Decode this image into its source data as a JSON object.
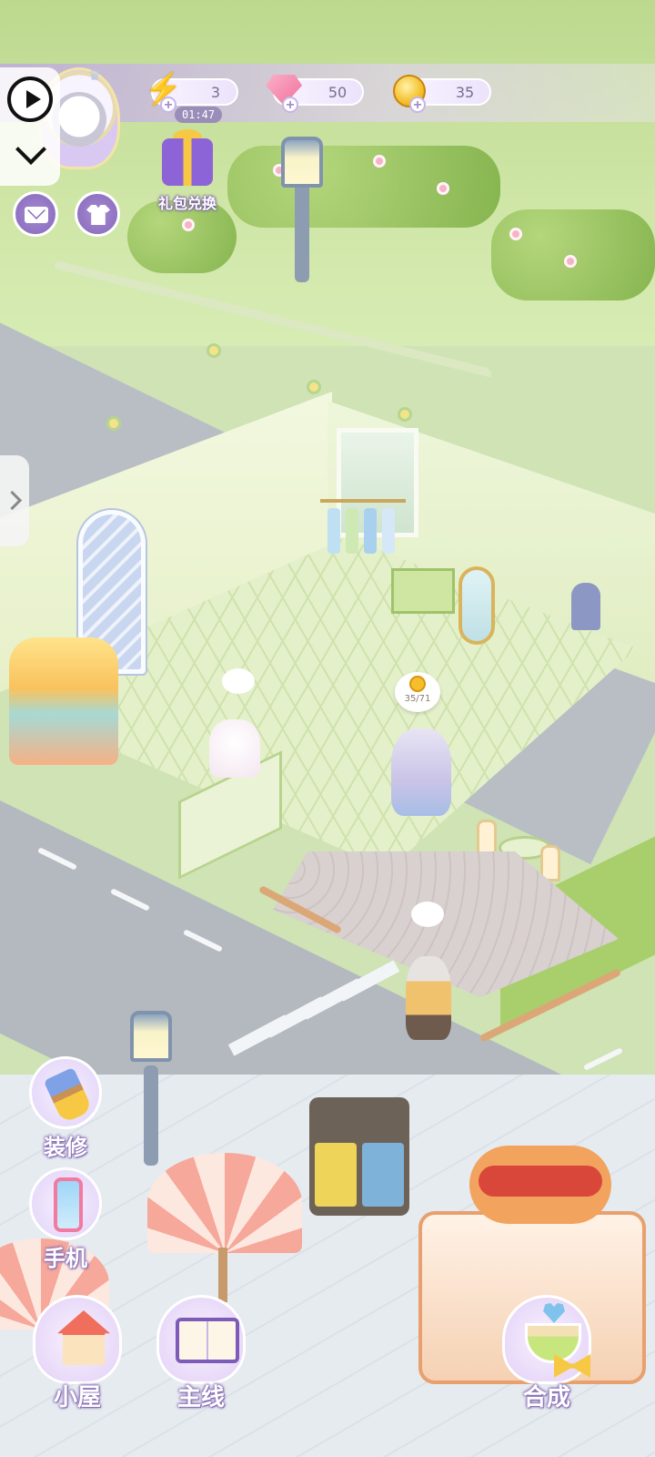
{
  "hud": {
    "energy": {
      "icon": "lightning-bolt-icon",
      "value": "3",
      "timer": "01:47",
      "plus": "+"
    },
    "gems": {
      "icon": "pink-gem-icon",
      "value": "50",
      "plus": "+"
    },
    "coins": {
      "icon": "gold-coin-icon",
      "value": "35",
      "plus": "+"
    },
    "gift_redeem": {
      "icon": "gift-box-icon",
      "label": "礼包兑换"
    },
    "mail": {
      "icon": "mail-icon"
    },
    "wardrobe": {
      "icon": "shirt-icon"
    }
  },
  "recorder": {
    "play_icon": "play-icon",
    "collapse_icon": "chevron-down-icon"
  },
  "side_menu": {
    "decorate": {
      "icon": "paint-brush-icon",
      "label": "装修"
    },
    "phone": {
      "icon": "phone-icon",
      "label": "手机"
    }
  },
  "bottom_menu": {
    "house": {
      "icon": "house-icon",
      "label": "小屋"
    },
    "main_quest": {
      "icon": "book-quill-icon",
      "label": "主线"
    },
    "merge": {
      "icon": "teacup-icon",
      "label": "合成"
    }
  },
  "scene": {
    "customer_bubble": {
      "icon": "coin-icon",
      "text": "35/71"
    }
  },
  "colors": {
    "hud_purple": "#8668ba",
    "label_outline": "#8a6fb6",
    "coin_gold": "#f4bf2b",
    "gem_pink": "#f06f9c"
  }
}
